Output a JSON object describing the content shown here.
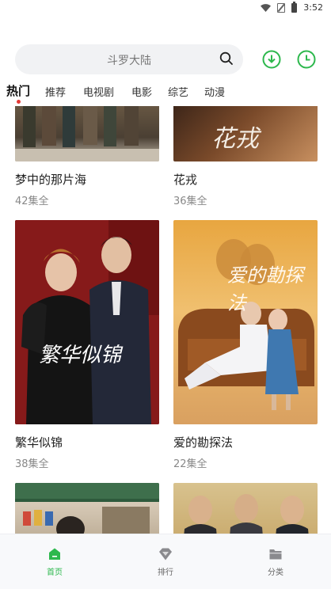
{
  "status_bar": {
    "time": "3:52"
  },
  "search": {
    "placeholder": "斗罗大陆"
  },
  "tabs": [
    {
      "label": "热门",
      "active": true
    },
    {
      "label": "推荐"
    },
    {
      "label": "电视剧"
    },
    {
      "label": "电影"
    },
    {
      "label": "综艺"
    },
    {
      "label": "动漫"
    }
  ],
  "shows": [
    {
      "title": "梦中的那片海",
      "episodes": "42集全"
    },
    {
      "title": "花戎",
      "episodes": "36集全",
      "poster_text": "花戎"
    },
    {
      "title": "繁华似锦",
      "episodes": "38集全",
      "poster_text": "繁华似锦"
    },
    {
      "title": "爱的勘探法",
      "episodes": "22集全",
      "poster_text": "爱的勘探法"
    }
  ],
  "bottom_nav": [
    {
      "label": "首页",
      "icon": "home-icon",
      "active": true
    },
    {
      "label": "排行",
      "icon": "diamond-icon"
    },
    {
      "label": "分类",
      "icon": "folder-icon"
    }
  ],
  "colors": {
    "accent": "#2db84d",
    "tab_dot": "#e53935"
  }
}
